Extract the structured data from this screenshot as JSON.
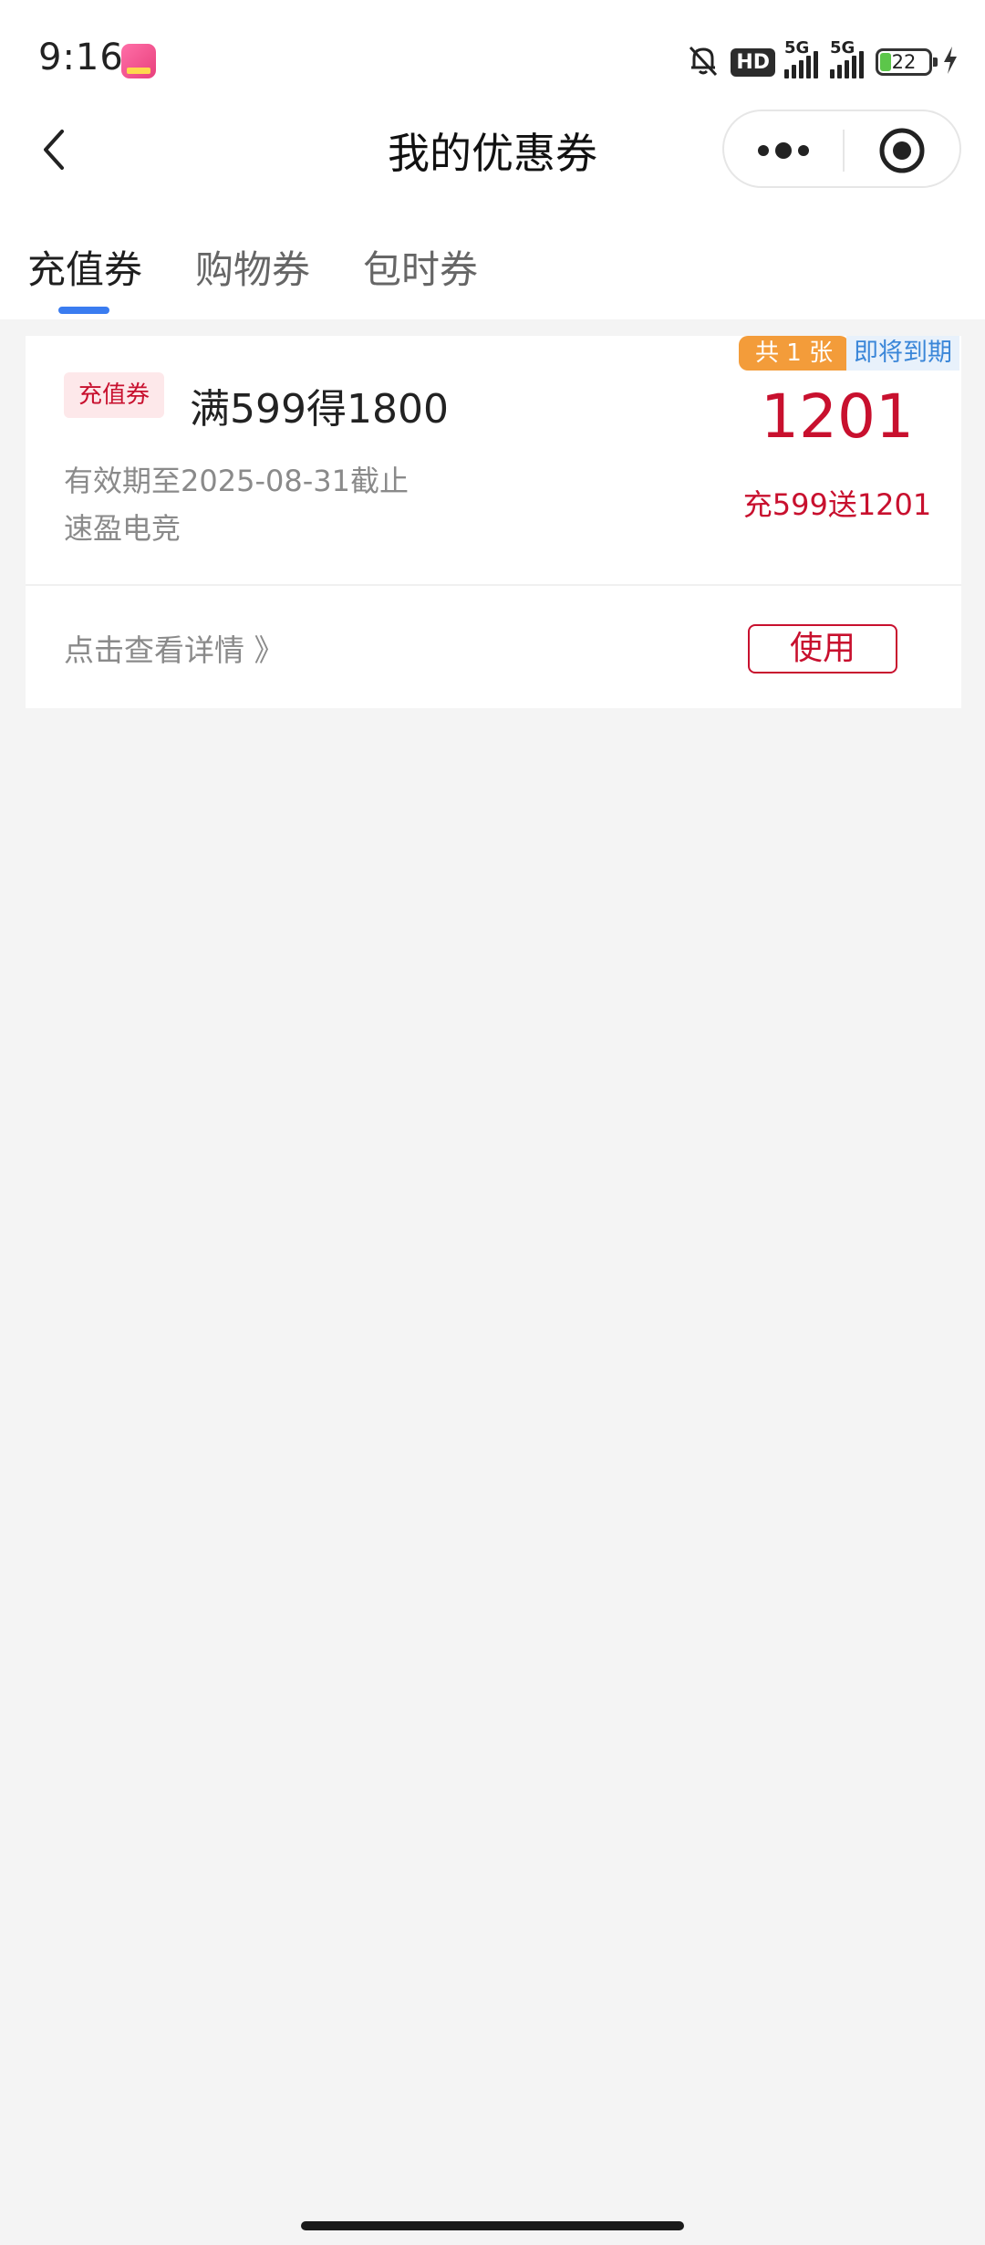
{
  "status_bar": {
    "time": "9:16",
    "app_icon": "app-icon",
    "hd_label": "HD",
    "network_1": "5G",
    "network_2": "5G",
    "battery_level": "22",
    "icons": [
      "mute-bell-icon",
      "signal-icon",
      "battery-icon",
      "charging-icon"
    ]
  },
  "nav": {
    "title": "我的优惠券",
    "back_icon": "back-chevron-icon",
    "more_icon": "more-dots-icon",
    "close_icon": "target-close-icon"
  },
  "tabs": [
    {
      "label": "充值券",
      "active": true
    },
    {
      "label": "购物券",
      "active": false
    },
    {
      "label": "包时券",
      "active": false
    }
  ],
  "colors": {
    "accent_blue": "#3a7cf0",
    "coupon_red": "#c8102e",
    "count_orange": "#f39c3a",
    "expiry_blue": "#3a86d8"
  },
  "coupon": {
    "tag": "充值券",
    "title": "满599得1800",
    "validity": "有效期至2025-08-31截止",
    "merchant": "速盈电竞",
    "count_badge": "共 1 张",
    "expiry_badge": "即将到期",
    "amount": "1201",
    "subtitle": "充599送1201",
    "details_link": "点击查看详情 》",
    "use_button": "使用"
  }
}
